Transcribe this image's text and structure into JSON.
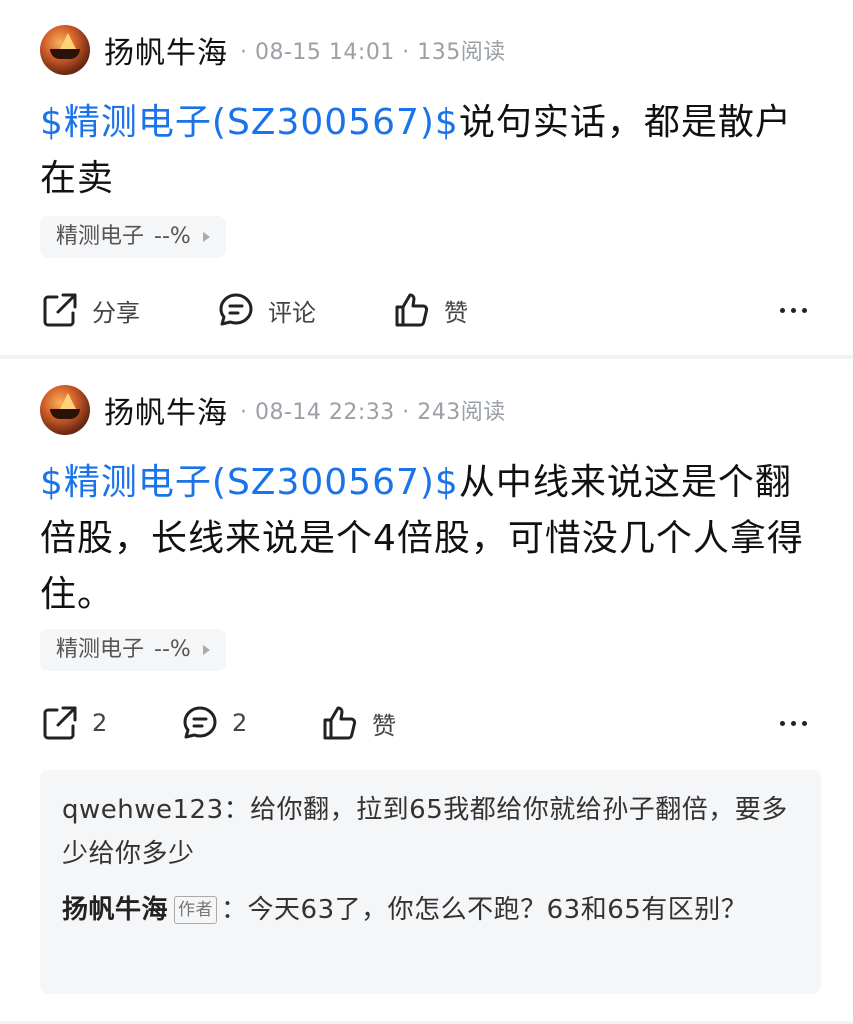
{
  "posts": [
    {
      "author": "扬帆牛海",
      "meta": "· 08-15 14:01 · 135阅读",
      "stock_link": "$精测电子(SZ300567)$",
      "text": "说句实话，都是散户在卖",
      "tag": {
        "name": "精测电子",
        "change": "--%"
      },
      "actions": {
        "share": "分享",
        "comment": "评论",
        "like": "赞"
      }
    },
    {
      "author": "扬帆牛海",
      "meta": "· 08-14 22:33 · 243阅读",
      "stock_link": "$精测电子(SZ300567)$",
      "text": "从中线来说这是个翻倍股，长线来说是个4倍股，可惜没几个人拿得住。",
      "tag": {
        "name": "精测电子",
        "change": "--%"
      },
      "actions": {
        "share": "2",
        "comment": "2",
        "like": "赞"
      },
      "replies": [
        {
          "name": "qwehwe123",
          "badge": "",
          "sep": "：",
          "text": "给你翻，拉到65我都给你就给孙子翻倍，要多少给你多少"
        },
        {
          "name": "扬帆牛海",
          "badge": "作者",
          "sep": "：",
          "text": "今天63了，你怎么不跑？63和65有区别？"
        }
      ]
    }
  ],
  "icons": {
    "share": "share-icon",
    "comment": "comment-icon",
    "like": "thumbs-up-icon",
    "more": "more-icon"
  },
  "colors": {
    "link": "#1a73e8",
    "meta": "#9aa0a6",
    "card_bg": "#f5f6f8"
  }
}
